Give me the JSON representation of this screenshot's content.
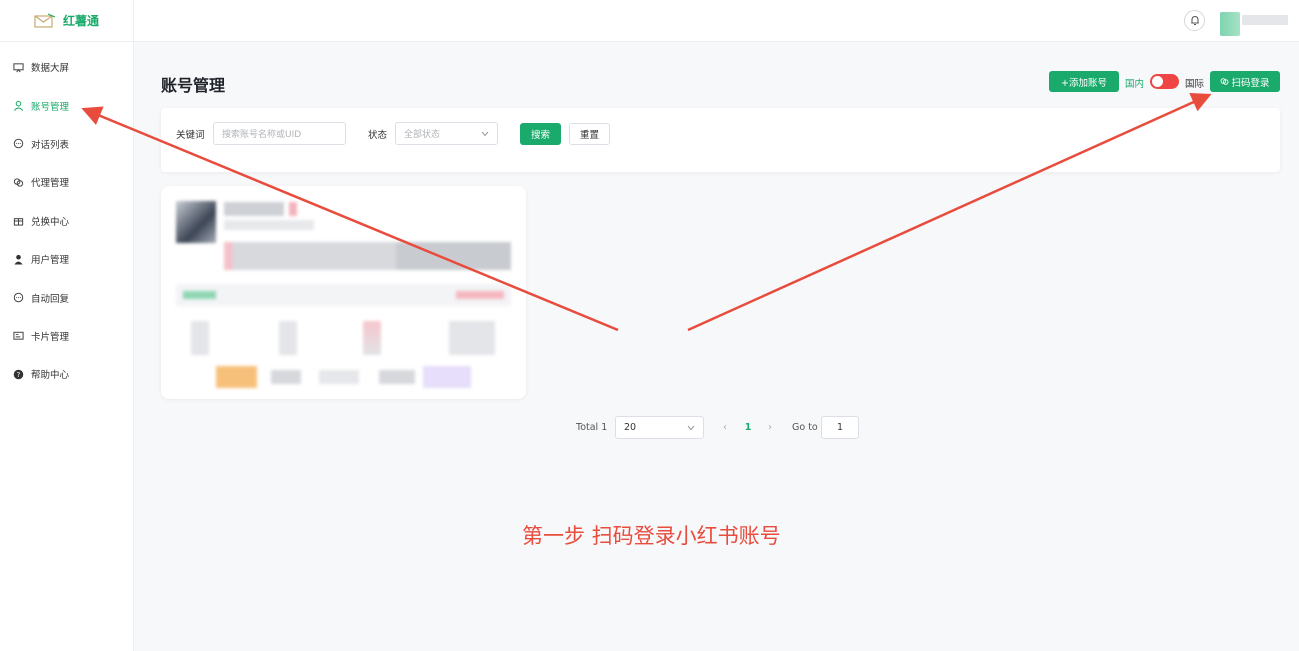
{
  "app": {
    "logo_text": "红薯通"
  },
  "sidebar": {
    "items": [
      {
        "label": "数据大屏",
        "icon": "monitor-icon"
      },
      {
        "label": "账号管理",
        "icon": "user-icon",
        "active": true
      },
      {
        "label": "对话列表",
        "icon": "chat-icon"
      },
      {
        "label": "代理管理",
        "icon": "link-icon"
      },
      {
        "label": "兑换中心",
        "icon": "gift-icon"
      },
      {
        "label": "用户管理",
        "icon": "person-icon"
      },
      {
        "label": "自动回复",
        "icon": "message-icon"
      },
      {
        "label": "卡片管理",
        "icon": "card-icon"
      },
      {
        "label": "帮助中心",
        "icon": "help-icon"
      }
    ]
  },
  "main": {
    "title": "账号管理",
    "add_button": "+添加账号",
    "region_domestic": "国内",
    "region_international": "国际",
    "scan_button": "扫码登录"
  },
  "filter": {
    "keyword_label": "关键词",
    "keyword_placeholder": "搜索账号名称或UID",
    "status_label": "状态",
    "status_value": "全部状态",
    "search_button": "搜索",
    "reset_button": "重置"
  },
  "pagination": {
    "total_text": "Total 1",
    "page_size": "20",
    "current_page": "1",
    "goto_label": "Go to",
    "goto_value": "1"
  },
  "annotation": {
    "caption": "第一步 扫码登录小红书账号",
    "color": "#e84c3d"
  },
  "colors": {
    "accent": "#1aaa6b",
    "toggle": "#f04545"
  }
}
